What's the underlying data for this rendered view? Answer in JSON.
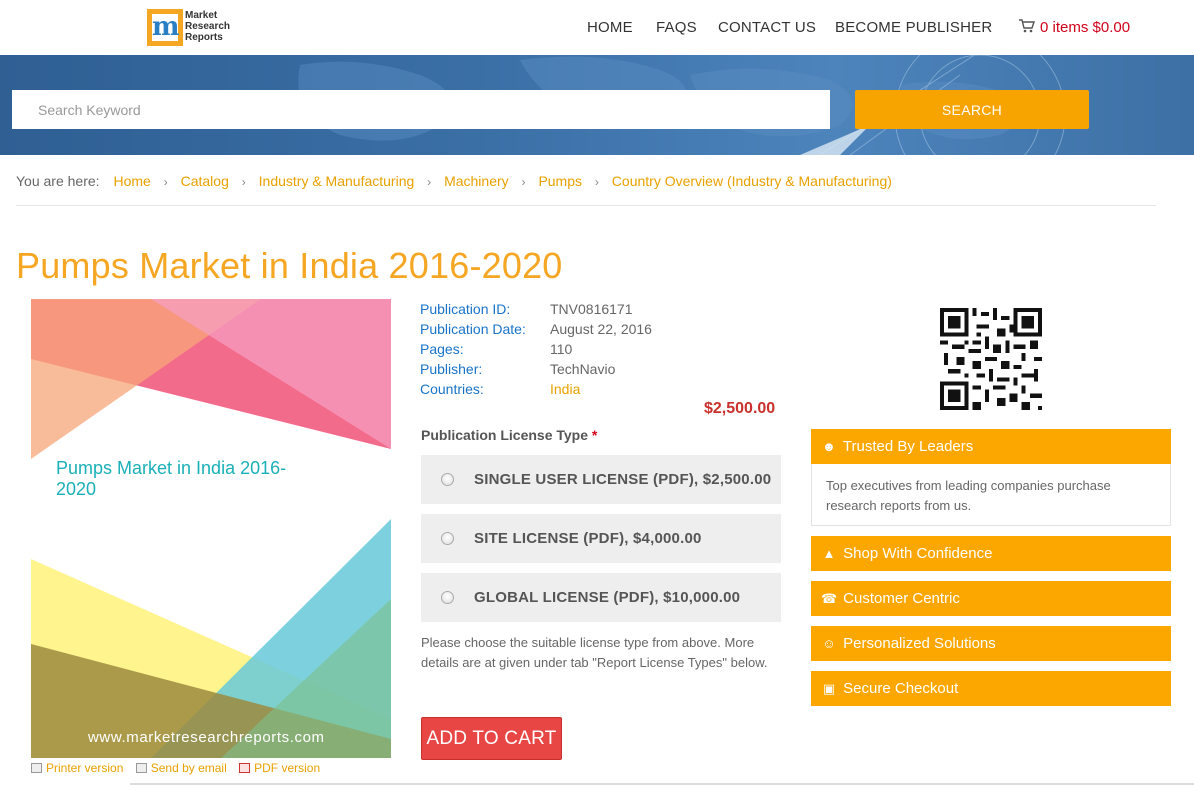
{
  "header": {
    "logo_text": [
      "Market",
      "Research",
      "Reports"
    ],
    "nav": [
      "HOME",
      "FAQS",
      "CONTACT US",
      "BECOME PUBLISHER"
    ],
    "cart_label": "0 items $0.00"
  },
  "search": {
    "placeholder": "Search Keyword",
    "button_label": "SEARCH"
  },
  "breadcrumb": {
    "label": "You are here:",
    "items": [
      "Home",
      "Catalog",
      "Industry & Manufacturing",
      "Machinery",
      "Pumps",
      "Country Overview (Industry & Manufacturing)"
    ]
  },
  "page_title": "Pumps Market in India 2016-2020",
  "cover": {
    "title": "Pumps Market in India 2016-2020",
    "url": "www.marketresearchreports.com"
  },
  "utilities": [
    "Printer version",
    "Send by email",
    "PDF version"
  ],
  "meta": [
    {
      "key": "Publication ID:",
      "value": "TNV0816171"
    },
    {
      "key": "Publication Date:",
      "value": "August 22, 2016"
    },
    {
      "key": "Pages:",
      "value": "110"
    },
    {
      "key": "Publisher:",
      "value": "TechNavio"
    },
    {
      "key": "Countries:",
      "value": "India"
    }
  ],
  "price": "$2,500.00",
  "license": {
    "label": "Publication License Type",
    "required_mark": "*",
    "options": [
      "SINGLE USER LICENSE (PDF), $2,500.00",
      "SITE LICENSE (PDF), $4,000.00",
      "GLOBAL LICENSE (PDF), $10,000.00"
    ],
    "note": "Please choose the suitable license type from above. More details are at given under tab \"Report License Types\" below."
  },
  "add_to_cart_label": "ADD TO CART",
  "sidebar": {
    "trusted": {
      "title": "Trusted By Leaders",
      "body": "Top executives from leading companies purchase research reports from us."
    },
    "items": [
      {
        "label": "Shop With Confidence",
        "icon": "thumbs-up-icon"
      },
      {
        "label": "Customer Centric",
        "icon": "phone-icon"
      },
      {
        "label": "Personalized Solutions",
        "icon": "smile-icon"
      },
      {
        "label": "Secure Checkout",
        "icon": "cart-icon"
      }
    ]
  },
  "colors": {
    "accent_orange": "#f5a623",
    "banner_blue": "#3a6fa6",
    "link_blue": "#1a73c8",
    "price_red": "#c9302c",
    "add_cart_red": "#e84545"
  }
}
